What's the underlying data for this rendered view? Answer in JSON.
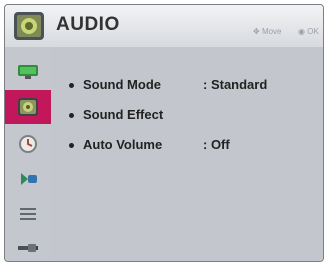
{
  "header": {
    "title": "AUDIO",
    "hint_move": "Move",
    "hint_ok": "OK"
  },
  "sidebar": {
    "items": [
      {
        "name": "picture",
        "icon": "monitor-icon",
        "active": false
      },
      {
        "name": "audio",
        "icon": "speaker-icon",
        "active": true
      },
      {
        "name": "time",
        "icon": "clock-icon",
        "active": false
      },
      {
        "name": "lock",
        "icon": "lock-icon",
        "active": false
      },
      {
        "name": "option",
        "icon": "options-icon",
        "active": false
      },
      {
        "name": "input",
        "icon": "input-icon",
        "active": false
      }
    ]
  },
  "menu": {
    "items": [
      {
        "label": "Sound Mode",
        "value": ": Standard"
      },
      {
        "label": "Sound Effect",
        "value": ""
      },
      {
        "label": "Auto Volume",
        "value": ": Off"
      }
    ]
  },
  "colors": {
    "active": "#c2185b",
    "panel": "#c3c7cd",
    "header": "#e8eaed"
  }
}
